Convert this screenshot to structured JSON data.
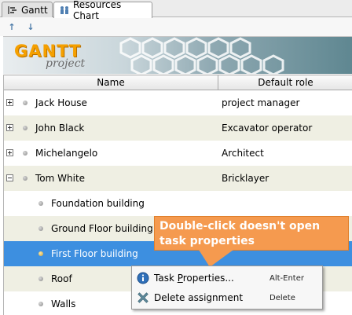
{
  "tabs": [
    {
      "label": "Gantt",
      "icon": "gantt-tab-icon",
      "active": false
    },
    {
      "label": "Resources Chart",
      "icon": "resources-tab-icon",
      "active": true
    }
  ],
  "toolbar": {
    "up_icon": "↑",
    "down_icon": "↓"
  },
  "banner": {
    "logo_main": "GANTT",
    "logo_sub": "project"
  },
  "table": {
    "columns": [
      "Name",
      "Default role"
    ],
    "rows": [
      {
        "name": "Jack House",
        "role": "project manager",
        "level": 0,
        "expander": "plus"
      },
      {
        "name": "John Black",
        "role": "Excavator operator",
        "level": 0,
        "expander": "plus"
      },
      {
        "name": "Michelangelo",
        "role": "Architect",
        "level": 0,
        "expander": "plus"
      },
      {
        "name": "Tom White",
        "role": "Bricklayer",
        "level": 0,
        "expander": "minus"
      },
      {
        "name": "Foundation building",
        "role": "",
        "level": 1,
        "expander": "none"
      },
      {
        "name": "Ground Floor building",
        "role": "",
        "level": 1,
        "expander": "none"
      },
      {
        "name": "First Floor building",
        "role": "",
        "level": 1,
        "expander": "none",
        "selected": true
      },
      {
        "name": "Roof",
        "role": "",
        "level": 1,
        "expander": "none"
      },
      {
        "name": "Walls",
        "role": "",
        "level": 1,
        "expander": "none"
      }
    ]
  },
  "callout": {
    "line1": "Double-click doesn't open",
    "line2": "task properties"
  },
  "context_menu": {
    "items": [
      {
        "label_before": "Task ",
        "label_underlined": "P",
        "label_after": "roperties...",
        "shortcut": "Alt-Enter",
        "icon": "info-icon"
      },
      {
        "label_before": "Delete assignment",
        "label_underlined": "",
        "label_after": "",
        "shortcut": "Delete",
        "icon": "delete-x-icon"
      }
    ]
  },
  "colors": {
    "selection": "#3d8fe0",
    "row_alt": "#efefe3",
    "callout": "#f59a4f",
    "logo_orange": "#f5a000"
  }
}
